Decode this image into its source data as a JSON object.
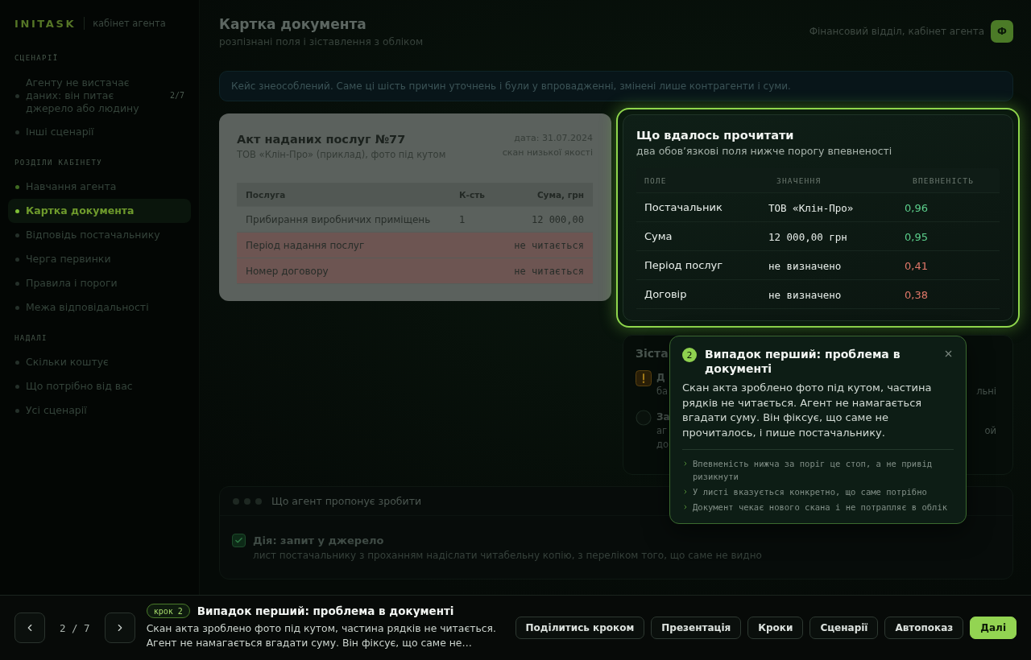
{
  "sidebar": {
    "logo": "INITASK",
    "logo_caption": "кабінет агента",
    "sections": [
      {
        "title": "СЦЕНАРІЇ",
        "items": [
          {
            "label": "Агенту не вистачає даних: він питає джерело або людину",
            "count": "2/7",
            "selected": false,
            "visited": false
          },
          {
            "label": "Інші сценарії",
            "selected": false,
            "visited": false
          }
        ]
      },
      {
        "title": "РОЗДІЛИ КАБІНЕТУ",
        "items": [
          {
            "label": "Навчання агента",
            "selected": false,
            "visited": true
          },
          {
            "label": "Картка документа",
            "selected": true,
            "visited": true
          },
          {
            "label": "Відповідь постачальнику",
            "selected": false,
            "visited": false
          },
          {
            "label": "Черга первинки",
            "selected": false,
            "visited": false
          },
          {
            "label": "Правила і пороги",
            "selected": false,
            "visited": false
          },
          {
            "label": "Межа відповідальності",
            "selected": false,
            "visited": false
          }
        ]
      },
      {
        "title": "НАДАЛІ",
        "items": [
          {
            "label": "Скільки коштує",
            "selected": false,
            "visited": false
          },
          {
            "label": "Що потрібно від вас",
            "selected": false,
            "visited": false
          },
          {
            "label": "Усі сценарії",
            "selected": false,
            "visited": false
          }
        ]
      }
    ]
  },
  "header": {
    "title": "Картка документа",
    "subtitle": "розпізнані поля і зіставлення з обліком",
    "user": "Фінансовий відділ, кабінет агента",
    "avatar": "Ф"
  },
  "notice": "Кейс знеособлений. Саме ці шість причин уточнень і були у впровадженні, змінені лише контрагенти і суми.",
  "document": {
    "title": "Акт наданих послуг №77",
    "subtitle": "ТОВ «Клін-Про» (приклад), фото під кутом",
    "date": "дата: 31.07.2024",
    "quality": "скан низької якості",
    "columns": [
      "Послуга",
      "К-сть",
      "Сума, грн"
    ],
    "rows": [
      {
        "service": "Прибирання виробничих приміщень",
        "qty": "1",
        "amount": "12 000,00",
        "unreadable": false
      },
      {
        "service": "Період надання послуг",
        "amount": "не читається",
        "unreadable": true
      },
      {
        "service": "Номер договору",
        "amount": "не читається",
        "unreadable": true
      }
    ]
  },
  "recognized": {
    "title": "Що вдалось прочитати",
    "subtitle": "два обов’язкові поля нижче порогу впевненості",
    "columns": [
      "ПОЛЕ",
      "ЗНАЧЕННЯ",
      "ВПЕВНЕНІСТЬ"
    ],
    "rows": [
      {
        "field": "Постачальник",
        "value": "ТОВ «Клін-Про»",
        "confidence": "0,96",
        "color": "#5ccf8c"
      },
      {
        "field": "Сума",
        "value": "12 000,00 грн",
        "confidence": "0,95",
        "color": "#5ccf8c"
      },
      {
        "field": "Період послуг",
        "value": "не визначено",
        "confidence": "0,41",
        "color": "#e2786a"
      },
      {
        "field": "Договір",
        "value": "не визначено",
        "confidence": "0,38",
        "color": "#e2786a"
      }
    ]
  },
  "matching": {
    "title": "Зіста",
    "items": [
      {
        "kind": "warning",
        "title": "Д",
        "lines": [
          {
            "start": "ба",
            "end": "льні"
          }
        ]
      },
      {
        "kind": "pending",
        "title": "За",
        "lines": [
          {
            "start": "аг",
            "end": "ой"
          },
          {
            "start": "до"
          }
        ]
      }
    ]
  },
  "proposal": {
    "title": "Що агент пропонує зробити",
    "actions": [
      {
        "title": "Дія: запит у джерело",
        "description": "лист постачальнику з проханням надіслати читабельну копію, з переліком того, що саме не видно",
        "checked": true
      }
    ]
  },
  "tour": {
    "step": "2",
    "title": "Випадок перший: проблема в документі",
    "body": "Скан акта зроблено фото під кутом, частина рядків не читається. Агент не намагається вгадати суму. Він фіксує, що саме не прочиталось, і пише постачальнику.",
    "notes": [
      "Впевненість нижча за поріг це стоп, а не привід ризикнути",
      "У листі вказується конкретно, що саме потрібно",
      "Документ чекає нового скана і не потрапляє в облік"
    ]
  },
  "footer": {
    "counter": "2 / 7",
    "step_badge": "крок 2",
    "title": "Випадок перший: проблема в документі",
    "description": "Скан акта зроблено фото під кутом, частина рядків не читається. Агент не намагається вгадати суму. Він фіксує, що саме не…",
    "buttons": [
      {
        "label": "Поділитись кроком",
        "primary": false
      },
      {
        "label": "Презентація",
        "primary": false
      },
      {
        "label": "Кроки",
        "primary": false
      },
      {
        "label": "Сценарії",
        "primary": false
      },
      {
        "label": "Автопоказ",
        "primary": false
      },
      {
        "label": "Далі",
        "primary": true
      }
    ]
  }
}
